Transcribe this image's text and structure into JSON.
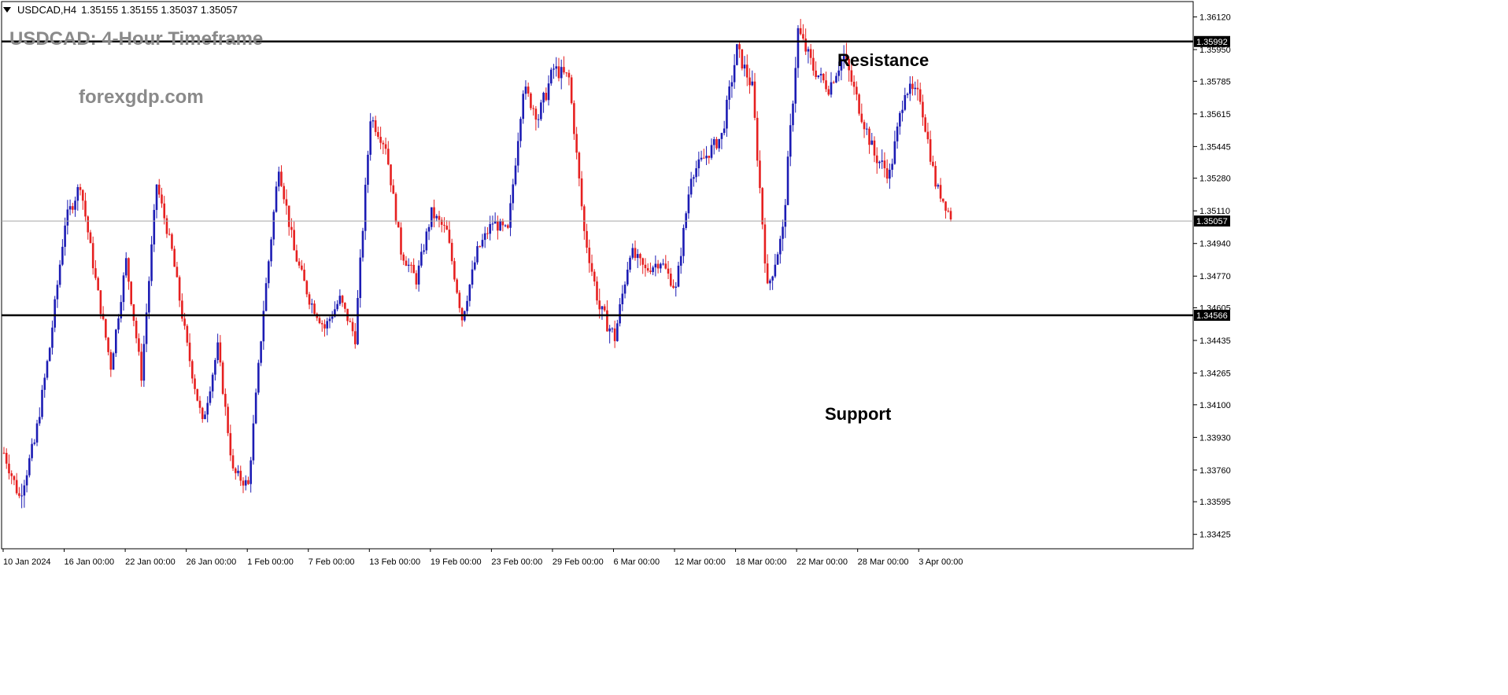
{
  "header": {
    "symbol_timeframe": "USDCAD,H4",
    "ohlc": "1.35155 1.35155 1.35037 1.35057"
  },
  "watermark": {
    "title": "USDCAD: 4-Hour Timeframe",
    "site": "forexgdp.com"
  },
  "levels": {
    "resistance": {
      "label": "Resistance",
      "price": 1.35992,
      "price_text": "1.35992"
    },
    "support": {
      "label": "Support",
      "price": 1.34566,
      "price_text": "1.34566"
    },
    "current": {
      "price": 1.35057,
      "price_text": "1.35057"
    }
  },
  "colors": {
    "bull": "#1c1cb4",
    "bear": "#e62020",
    "axis": "#000000",
    "current_line": "#a8a8a8"
  },
  "chart_data": {
    "type": "candlestick",
    "title": "USDCAD: 4-Hour Timeframe",
    "ylim": [
      1.3335,
      1.362
    ],
    "y_ticks": [
      "1.36120",
      "1.35950",
      "1.35785",
      "1.35615",
      "1.35445",
      "1.35280",
      "1.35110",
      "1.34940",
      "1.34770",
      "1.34605",
      "1.34435",
      "1.34265",
      "1.34100",
      "1.33930",
      "1.33760",
      "1.33595",
      "1.33425"
    ],
    "x_ticks": [
      "10 Jan 2024",
      "16 Jan 00:00",
      "22 Jan 00:00",
      "26 Jan 00:00",
      "1 Feb 00:00",
      "7 Feb 00:00",
      "13 Feb 00:00",
      "19 Feb 00:00",
      "23 Feb 00:00",
      "29 Feb 00:00",
      "6 Mar 00:00",
      "12 Mar 00:00",
      "18 Mar 00:00",
      "22 Mar 00:00",
      "28 Mar 00:00",
      "3 Apr 00:00"
    ],
    "anchors": [
      {
        "price": 1.3385,
        "wick": 0.0006
      },
      {
        "price": 1.3362,
        "wick": 0.0012
      },
      {
        "price": 1.339,
        "wick": 0.001
      },
      {
        "price": 1.344,
        "wick": 0.0008
      },
      {
        "price": 1.3505,
        "wick": 0.001
      },
      {
        "price": 1.3525,
        "wick": 0.0008
      },
      {
        "price": 1.3475,
        "wick": 0.0008
      },
      {
        "price": 1.343,
        "wick": 0.0008
      },
      {
        "price": 1.3485,
        "wick": 0.0008
      },
      {
        "price": 1.3425,
        "wick": 0.0008
      },
      {
        "price": 1.3525,
        "wick": 0.0008
      },
      {
        "price": 1.349,
        "wick": 0.0007
      },
      {
        "price": 1.344,
        "wick": 0.001
      },
      {
        "price": 1.34,
        "wick": 0.0008
      },
      {
        "price": 1.344,
        "wick": 0.0008
      },
      {
        "price": 1.3375,
        "wick": 0.0008
      },
      {
        "price": 1.3368,
        "wick": 0.0008
      },
      {
        "price": 1.346,
        "wick": 0.0008
      },
      {
        "price": 1.3535,
        "wick": 0.001
      },
      {
        "price": 1.349,
        "wick": 0.0008
      },
      {
        "price": 1.3465,
        "wick": 0.0008
      },
      {
        "price": 1.345,
        "wick": 0.0008
      },
      {
        "price": 1.3465,
        "wick": 0.0008
      },
      {
        "price": 1.3445,
        "wick": 0.0008
      },
      {
        "price": 1.356,
        "wick": 0.001
      },
      {
        "price": 1.3545,
        "wick": 0.0008
      },
      {
        "price": 1.349,
        "wick": 0.0008
      },
      {
        "price": 1.3475,
        "wick": 0.0008
      },
      {
        "price": 1.351,
        "wick": 0.0008
      },
      {
        "price": 1.35,
        "wick": 0.0008
      },
      {
        "price": 1.3455,
        "wick": 0.0008
      },
      {
        "price": 1.349,
        "wick": 0.0008
      },
      {
        "price": 1.3505,
        "wick": 0.0008
      },
      {
        "price": 1.35,
        "wick": 0.0008
      },
      {
        "price": 1.3575,
        "wick": 0.001
      },
      {
        "price": 1.356,
        "wick": 0.001
      },
      {
        "price": 1.3585,
        "wick": 0.0012
      },
      {
        "price": 1.358,
        "wick": 0.0008
      },
      {
        "price": 1.35,
        "wick": 0.0008
      },
      {
        "price": 1.346,
        "wick": 0.001
      },
      {
        "price": 1.3445,
        "wick": 0.0012
      },
      {
        "price": 1.349,
        "wick": 0.001
      },
      {
        "price": 1.348,
        "wick": 0.0008
      },
      {
        "price": 1.3485,
        "wick": 0.0008
      },
      {
        "price": 1.347,
        "wick": 0.0008
      },
      {
        "price": 1.353,
        "wick": 0.0008
      },
      {
        "price": 1.354,
        "wick": 0.0008
      },
      {
        "price": 1.355,
        "wick": 0.001
      },
      {
        "price": 1.3595,
        "wick": 0.001
      },
      {
        "price": 1.3575,
        "wick": 0.001
      },
      {
        "price": 1.347,
        "wick": 0.001
      },
      {
        "price": 1.35,
        "wick": 0.001
      },
      {
        "price": 1.3605,
        "wick": 0.0012
      },
      {
        "price": 1.3585,
        "wick": 0.001
      },
      {
        "price": 1.3575,
        "wick": 0.0008
      },
      {
        "price": 1.3592,
        "wick": 0.001
      },
      {
        "price": 1.3565,
        "wick": 0.001
      },
      {
        "price": 1.354,
        "wick": 0.001
      },
      {
        "price": 1.353,
        "wick": 0.001
      },
      {
        "price": 1.3575,
        "wick": 0.001
      },
      {
        "price": 1.357,
        "wick": 0.001
      },
      {
        "price": 1.3525,
        "wick": 0.0008
      },
      {
        "price": 1.3508,
        "wick": 0.0006
      }
    ]
  }
}
